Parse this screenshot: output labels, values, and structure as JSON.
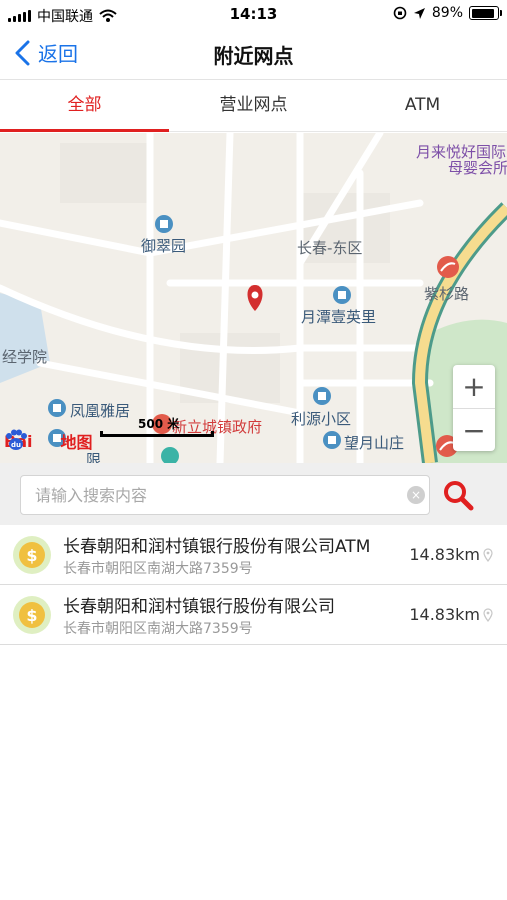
{
  "status_bar": {
    "carrier": "中国联通",
    "time": "14:13",
    "battery": "89%",
    "battery_level": 0.89
  },
  "nav": {
    "back_label": "返回",
    "title": "附近网点"
  },
  "tabs": [
    {
      "label": "全部",
      "active": true
    },
    {
      "label": "营业网点",
      "active": false
    },
    {
      "label": "ATM",
      "active": false
    }
  ],
  "map": {
    "labels": {
      "yuecuiyuan": "御翠园",
      "changchun_east": "长春-东区",
      "yuelai_1": "月来悦好国际",
      "yuelai_2": "母婴会所",
      "zishan_road": "紫杉路",
      "yuetan": "月潭壹英里",
      "jingxueyuan": "经学院",
      "fenghuang": "凤凰雅居",
      "xinli_gov": "新立城镇政府",
      "liyuan": "利源小区",
      "wangyueshan": "望月山庄",
      "cut_label": "限"
    },
    "scale_text": "500 米",
    "logo_text_left": "Bai",
    "logo_text_paw": "du",
    "logo_text_right": "地图",
    "zoom_in": "+",
    "zoom_out": "−"
  },
  "search": {
    "placeholder": "请输入搜索内容",
    "value": "",
    "clear_icon": "×"
  },
  "results": [
    {
      "name": "长春朝阳和润村镇银行股份有限公司ATM",
      "address": "长春市朝阳区南湖大路7359号",
      "distance": "14.83km"
    },
    {
      "name": "长春朝阳和润村镇银行股份有限公司",
      "address": "长春市朝阳区南湖大路7359号",
      "distance": "14.83km"
    }
  ],
  "colors": {
    "accent_red": "#e02020",
    "link_blue": "#1a73e8",
    "coin_green": "#cfe5a6",
    "coin_gold": "#f0c040"
  }
}
